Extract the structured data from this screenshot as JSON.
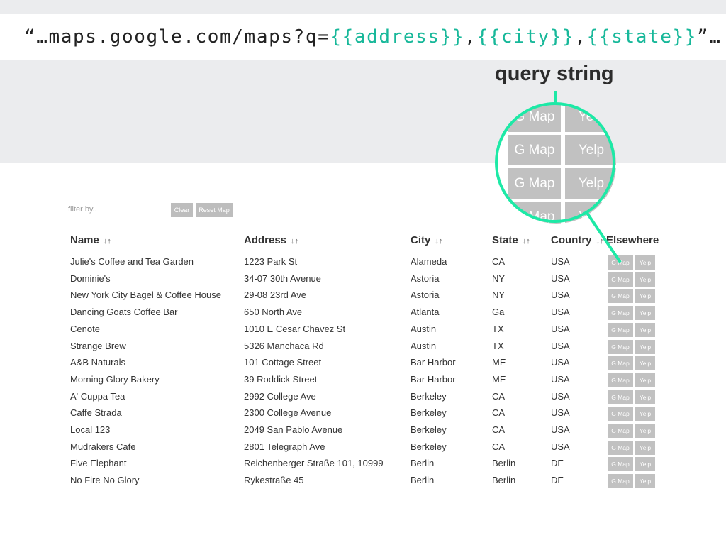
{
  "url_template": {
    "prefix": "“…maps.google.com/maps?q=",
    "address_var": "{{address}}",
    "sep1": ",",
    "city_var": "{{city}}",
    "sep2": ",",
    "state_var": "{{state}}",
    "suffix": "”…"
  },
  "annotation": {
    "label": "query string",
    "magnifier_buttons": [
      "G Map",
      "Yelp",
      "G Map",
      "Yelp"
    ],
    "ring_color": "#1de9a6"
  },
  "filter": {
    "placeholder": "filter by..",
    "value": "",
    "clear_label": "Clear",
    "reset_map_label": "Reset Map"
  },
  "table": {
    "sort_glyph": "↓↑",
    "headers": {
      "name": "Name",
      "address": "Address",
      "city": "City",
      "state": "State",
      "country": "Country",
      "elsewhere": "Elsewhere"
    },
    "gmap_label": "G Map",
    "yelp_label": "Yelp",
    "rows": [
      {
        "name": "Julie's Coffee and Tea Garden",
        "address": "1223 Park St",
        "city": "Alameda",
        "state": "CA",
        "country": "USA"
      },
      {
        "name": "Dominie's",
        "address": "34-07 30th Avenue",
        "city": "Astoria",
        "state": "NY",
        "country": "USA"
      },
      {
        "name": "New York City Bagel & Coffee House",
        "address": "29-08 23rd Ave",
        "city": "Astoria",
        "state": "NY",
        "country": "USA"
      },
      {
        "name": "Dancing Goats Coffee Bar",
        "address": "650 North Ave",
        "city": "Atlanta",
        "state": "Ga",
        "country": "USA"
      },
      {
        "name": "Cenote",
        "address": "1010 E Cesar Chavez St",
        "city": "Austin",
        "state": "TX",
        "country": "USA"
      },
      {
        "name": "Strange Brew",
        "address": "5326 Manchaca Rd",
        "city": "Austin",
        "state": "TX",
        "country": "USA"
      },
      {
        "name": "A&B Naturals",
        "address": "101 Cottage Street",
        "city": "Bar Harbor",
        "state": "ME",
        "country": "USA"
      },
      {
        "name": "Morning Glory Bakery",
        "address": "39 Roddick Street",
        "city": "Bar Harbor",
        "state": "ME",
        "country": "USA"
      },
      {
        "name": "A' Cuppa Tea",
        "address": "2992 College Ave",
        "city": "Berkeley",
        "state": "CA",
        "country": "USA"
      },
      {
        "name": "Caffe Strada",
        "address": "2300 College Avenue",
        "city": "Berkeley",
        "state": "CA",
        "country": "USA"
      },
      {
        "name": "Local 123",
        "address": "2049 San Pablo Avenue",
        "city": "Berkeley",
        "state": "CA",
        "country": "USA"
      },
      {
        "name": "Mudrakers Cafe",
        "address": "2801 Telegraph Ave",
        "city": "Berkeley",
        "state": "CA",
        "country": "USA"
      },
      {
        "name": "Five Elephant",
        "address": "Reichenberger Straße 101, 10999",
        "city": "Berlin",
        "state": "Berlin",
        "country": "DE"
      },
      {
        "name": "No Fire No Glory",
        "address": "Rykestraße 45",
        "city": "Berlin",
        "state": "Berlin",
        "country": "DE"
      }
    ]
  }
}
